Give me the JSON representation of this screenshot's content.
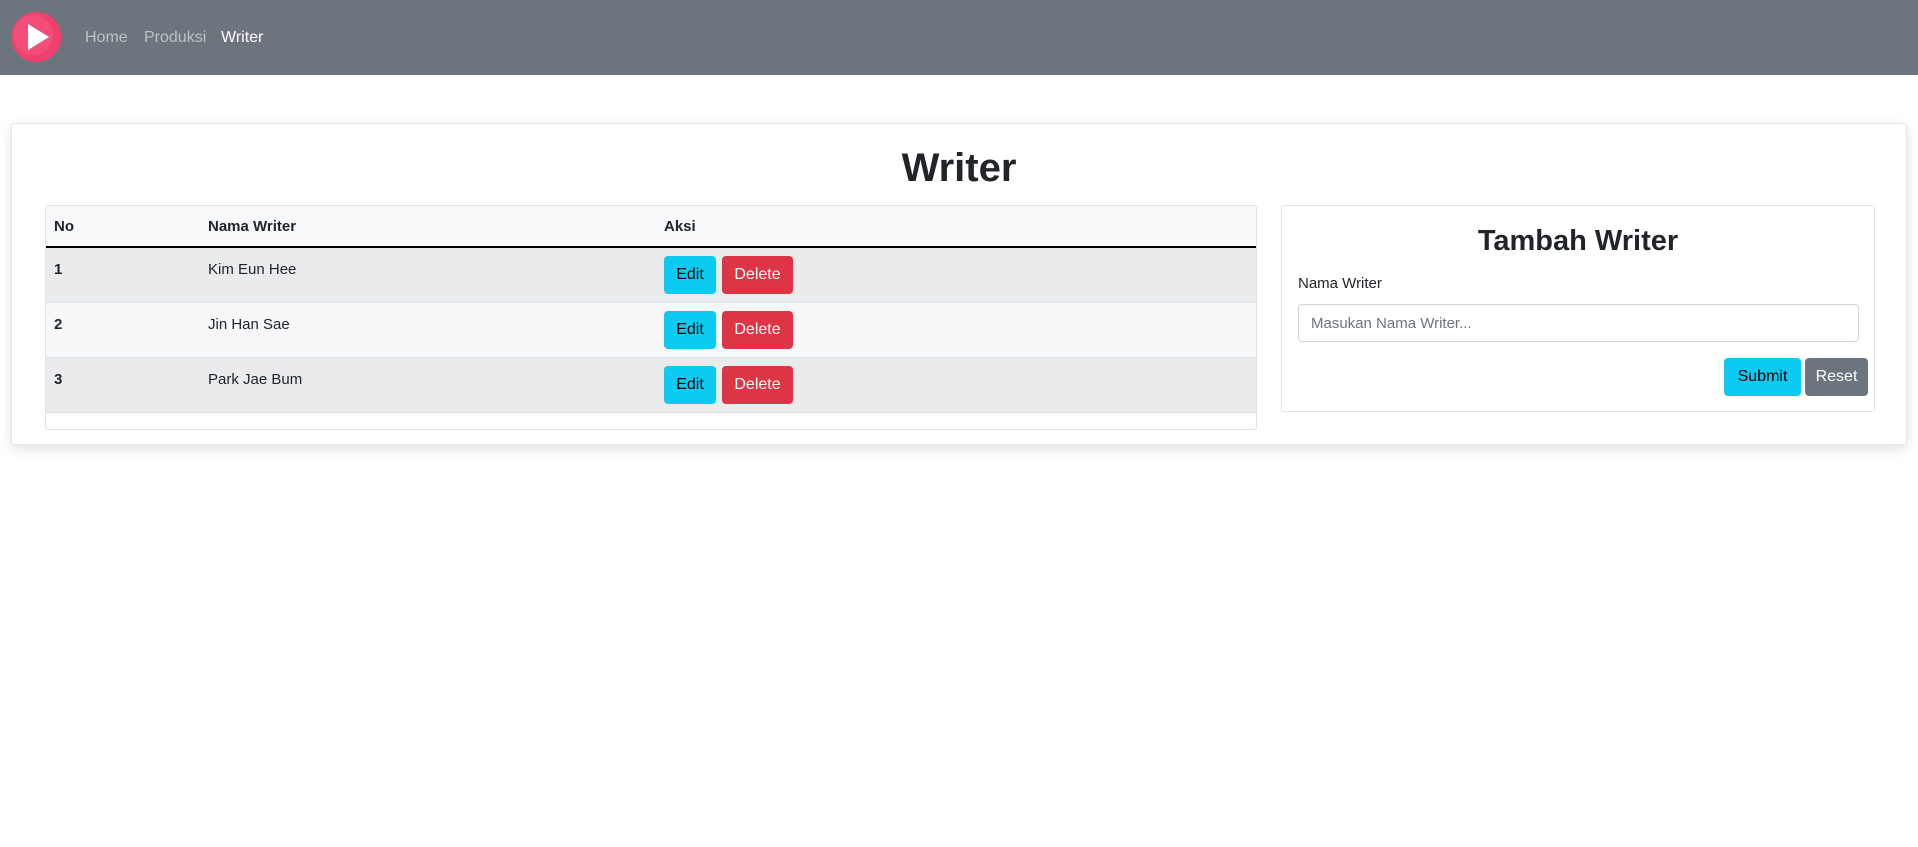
{
  "navbar": {
    "logo_icon": "play-logo-icon",
    "links": [
      {
        "label": "Home",
        "active": false
      },
      {
        "label": "Produksi",
        "active": false
      },
      {
        "label": "Writer",
        "active": true
      }
    ]
  },
  "page": {
    "title": "Writer"
  },
  "table": {
    "headers": [
      "No",
      "Nama Writer",
      "Aksi"
    ],
    "rows": [
      {
        "no": "1",
        "nama": "Kim Eun Hee",
        "edit_label": "Edit",
        "delete_label": "Delete"
      },
      {
        "no": "2",
        "nama": "Jin Han Sae",
        "edit_label": "Edit",
        "delete_label": "Delete"
      },
      {
        "no": "3",
        "nama": "Park Jae Bum",
        "edit_label": "Edit",
        "delete_label": "Delete"
      }
    ]
  },
  "form": {
    "title": "Tambah Writer",
    "label": "Nama Writer",
    "placeholder": "Masukan Nama Writer...",
    "value": "",
    "submit_label": "Submit",
    "reset_label": "Reset"
  },
  "colors": {
    "navbar": "#6c757d",
    "info": "#0dcaf0",
    "danger": "#dc3545",
    "secondary": "#6c757d",
    "logo": "#f0416e"
  }
}
